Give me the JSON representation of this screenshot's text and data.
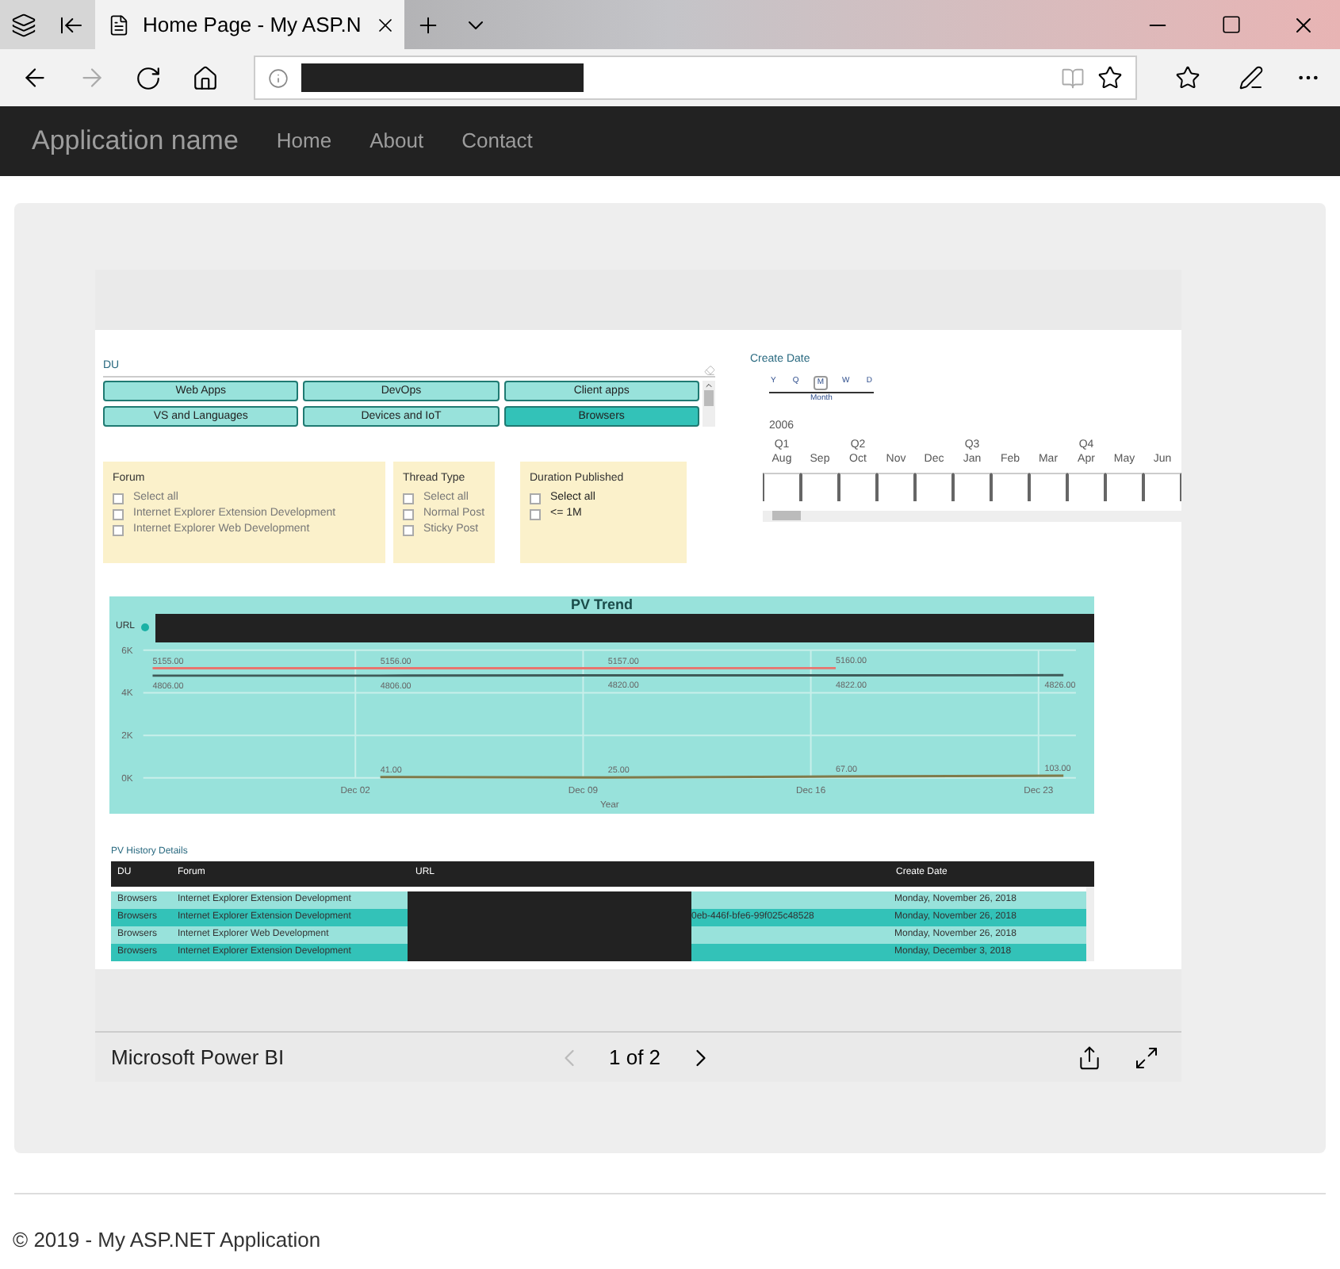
{
  "browser": {
    "tabs": [
      {
        "title": "Home Page - My ASP.N",
        "selected": true
      }
    ]
  },
  "navbar": {
    "brand": "Application name",
    "links": [
      "Home",
      "About",
      "Contact"
    ]
  },
  "report": {
    "du_slicer": {
      "title": "DU",
      "buttons": [
        {
          "label": "Web Apps",
          "selected": false
        },
        {
          "label": "DevOps",
          "selected": false
        },
        {
          "label": "Client apps",
          "selected": false
        },
        {
          "label": "VS and Languages",
          "selected": false
        },
        {
          "label": "Devices and IoT",
          "selected": false
        },
        {
          "label": "Browsers",
          "selected": true
        }
      ]
    },
    "forum": {
      "title": "Forum",
      "items": [
        {
          "label": "Select all",
          "checked": false
        },
        {
          "label": "Internet Explorer Extension Development",
          "checked": false
        },
        {
          "label": "Internet Explorer Web Development",
          "checked": false
        }
      ]
    },
    "thread_type": {
      "title": "Thread Type",
      "items": [
        {
          "label": "Select all",
          "checked": false
        },
        {
          "label": "Normal Post",
          "checked": false
        },
        {
          "label": "Sticky Post",
          "checked": false
        }
      ]
    },
    "duration": {
      "title": "Duration Published",
      "items": [
        {
          "label": "Select all",
          "checked": false
        },
        {
          "label": "<= 1M",
          "checked": false
        }
      ]
    },
    "date_slicer": {
      "title": "Create Date",
      "granularity": [
        {
          "label": "Y",
          "selected": false
        },
        {
          "label": "Q",
          "selected": false
        },
        {
          "label": "M",
          "selected": true
        },
        {
          "label": "W",
          "selected": false
        },
        {
          "label": "D",
          "selected": false
        }
      ],
      "granularity_caption": "Month",
      "year": "2006",
      "months": [
        {
          "label": "Aug",
          "quarter": "Q1"
        },
        {
          "label": "Sep"
        },
        {
          "label": "Oct",
          "quarter": "Q2"
        },
        {
          "label": "Nov"
        },
        {
          "label": "Dec"
        },
        {
          "label": "Jan",
          "quarter": "Q3"
        },
        {
          "label": "Feb"
        },
        {
          "label": "Mar"
        },
        {
          "label": "Apr",
          "quarter": "Q4"
        },
        {
          "label": "May"
        },
        {
          "label": "Jun"
        }
      ]
    },
    "pv_trend": {
      "title": "PV Trend",
      "legend_title": "URL",
      "chart_data": {
        "type": "line",
        "xlabel": "Year",
        "categories": [
          null,
          "Dec 02",
          "Dec 09",
          "Dec 16",
          "Dec 23"
        ],
        "ylim": [
          0,
          6000
        ],
        "grid": true,
        "yticks": [
          {
            "value": 0,
            "label": "0K"
          },
          {
            "value": 2000,
            "label": "2K"
          },
          {
            "value": 4000,
            "label": "4K"
          },
          {
            "value": 6000,
            "label": "6K"
          }
        ],
        "series": [
          {
            "color": "#e8756f",
            "values": [
              5155,
              5156,
              5157,
              5160,
              null
            ],
            "value_labels": [
              "5155.00",
              "5156.00",
              "5157.00",
              "5160.00",
              null
            ]
          },
          {
            "color": "#3f5a58",
            "values": [
              4806,
              4806,
              4820,
              4822,
              4826
            ],
            "value_labels": [
              "4806.00",
              "4806.00",
              "4820.00",
              "4822.00",
              "4826.00"
            ]
          },
          {
            "color": "#7f7a4a",
            "values": [
              null,
              41,
              25,
              67,
              103
            ],
            "value_labels": [
              null,
              "41.00",
              "25.00",
              "67.00",
              "103.00"
            ]
          }
        ]
      }
    },
    "details": {
      "title": "PV History Details",
      "columns": [
        "DU",
        "Forum",
        "URL",
        "Create Date"
      ],
      "rows": [
        {
          "du": "Browsers",
          "forum": "Internet Explorer Extension Development",
          "create_date": "Monday, November 26, 2018"
        },
        {
          "du": "Browsers",
          "forum": "Internet Explorer Extension Development",
          "url_tail": "0eb-446f-bfe6-99f025c48528",
          "create_date": "Monday, November 26, 2018"
        },
        {
          "du": "Browsers",
          "forum": "Internet Explorer Web Development",
          "create_date": "Monday, November 26, 2018"
        },
        {
          "du": "Browsers",
          "forum": "Internet Explorer Extension Development",
          "create_date": "Monday, December 3, 2018"
        }
      ]
    }
  },
  "powerbi_bar": {
    "brand": "Microsoft Power BI",
    "page": "1 of 2"
  },
  "footer": "© 2019 - My ASP.NET Application"
}
